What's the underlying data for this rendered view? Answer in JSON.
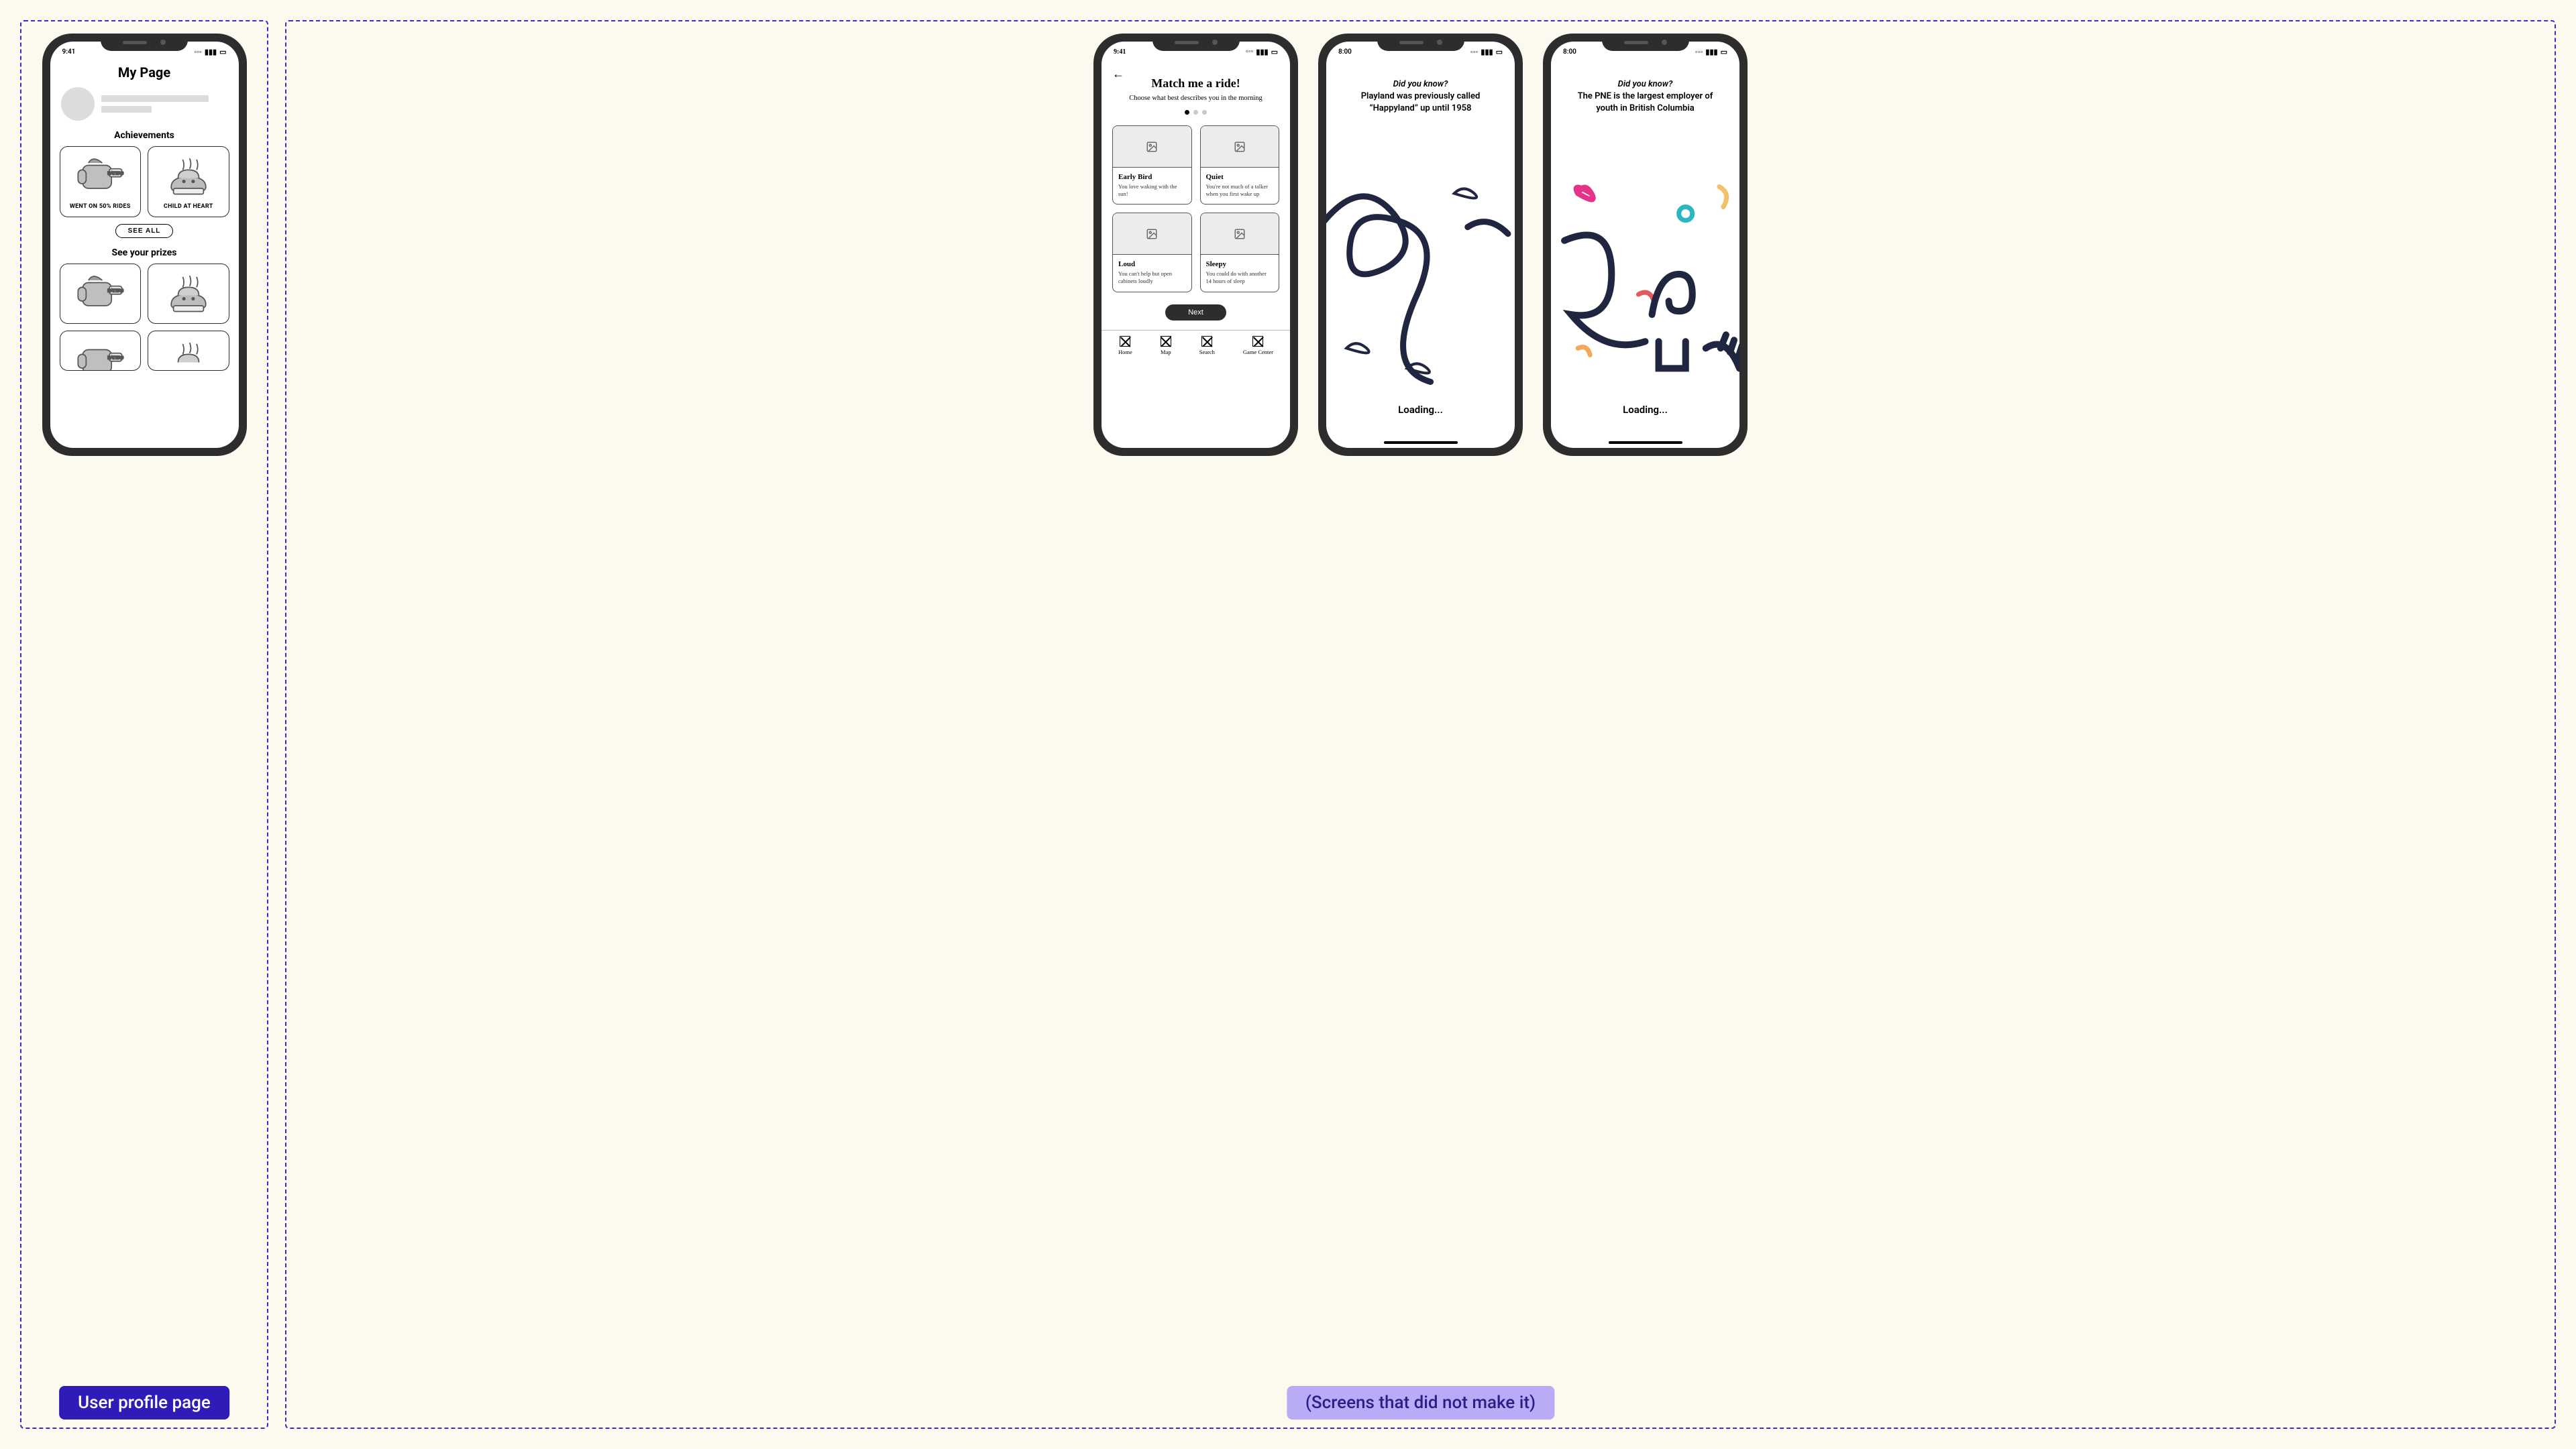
{
  "labels": {
    "left": "User profile page",
    "right": "(Screens that did not make it)"
  },
  "status": {
    "time1": "9:41",
    "time2": "8:00"
  },
  "profile": {
    "title": "My Page",
    "achievements_head": "Achievements",
    "cards": [
      {
        "caption": "WENT ON 50% RIDES"
      },
      {
        "caption": "CHILD AT HEART"
      }
    ],
    "see_all": "SEE ALL",
    "prizes_head": "See your prizes"
  },
  "quiz": {
    "title": "Match me a ride!",
    "subtitle": "Choose what best describes you in the morning",
    "options": [
      {
        "name": "Early Bird",
        "desc": "You love waking with the sun!"
      },
      {
        "name": "Quiet",
        "desc": "You're not much of a talker when you first wake up"
      },
      {
        "name": "Loud",
        "desc": "You can't help but open cabinets loudly"
      },
      {
        "name": "Sleepy",
        "desc": "You could do with another 14 hours of sleep"
      }
    ],
    "next": "Next",
    "tabs": [
      "Home",
      "Map",
      "Search",
      "Game Center"
    ]
  },
  "loading": {
    "did": "Did you know?",
    "fact1": "Playland was previously called “Happyland” up until 1958",
    "fact2": "The PNE is the largest employer of youth in British Columbia",
    "text": "Loading..."
  }
}
